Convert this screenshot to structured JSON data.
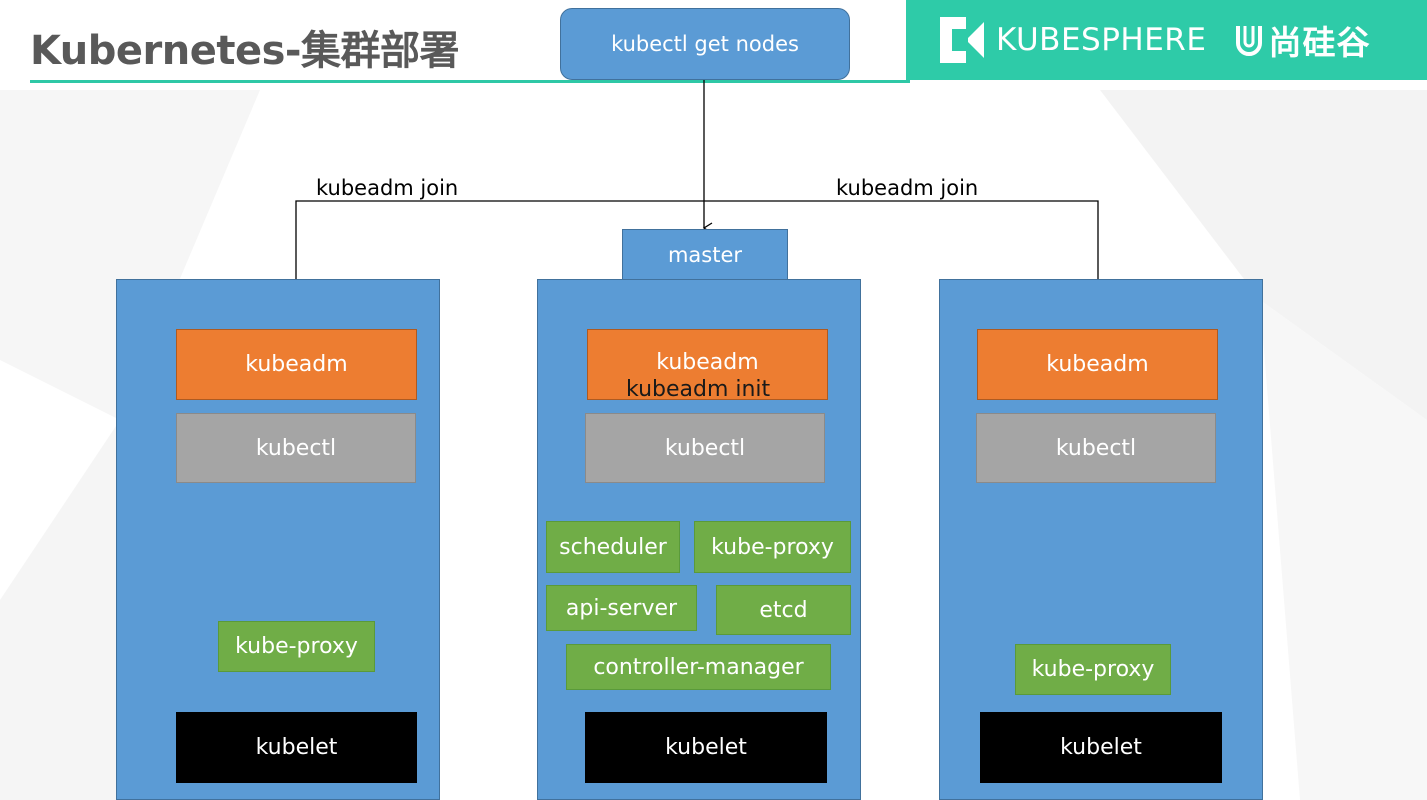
{
  "header": {
    "title": "Kubernetes-集群部署",
    "brand_name": "KUBESPHERE",
    "brand_cn": "尚硅谷"
  },
  "command": {
    "label": "kubectl get nodes"
  },
  "edges": {
    "left_join": "kubeadm join",
    "right_join": "kubeadm join"
  },
  "master": {
    "tab_label": "master",
    "kubeadm": "kubeadm",
    "kubeadm_init": "kubeadm init",
    "kubectl": "kubectl",
    "components": {
      "scheduler": "scheduler",
      "kube_proxy": "kube-proxy",
      "api_server": "api-server",
      "etcd": "etcd",
      "controller_manager": "controller-manager"
    },
    "kubelet": "kubelet"
  },
  "left_node": {
    "kubeadm": "kubeadm",
    "kubectl": "kubectl",
    "kube_proxy": "kube-proxy",
    "kubelet": "kubelet"
  },
  "right_node": {
    "kubeadm": "kubeadm",
    "kubectl": "kubectl",
    "kube_proxy": "kube-proxy",
    "kubelet": "kubelet"
  },
  "colors": {
    "node_blue": "#5b9bd5",
    "kubeadm_orange": "#ed7d31",
    "kubectl_gray": "#a5a5a5",
    "component_green": "#70ad47",
    "kubelet_black": "#000000",
    "brand_teal": "#2ecba8"
  }
}
